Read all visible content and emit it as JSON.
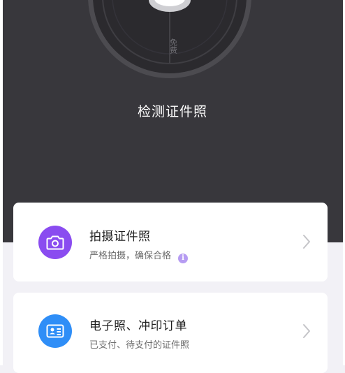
{
  "hero": {
    "title": "检测证件照",
    "dial_label": "免费"
  },
  "cards": [
    {
      "title": "拍摄证件照",
      "subtitle": "严格拍摄，确保合格",
      "icon": "camera-icon",
      "info_icon": "info-icon",
      "info_glyph": "i",
      "icon_color": "#8a4cf0"
    },
    {
      "title": "电子照、冲印订单",
      "subtitle": "已支付、待支付的证件照",
      "icon": "id-card-icon",
      "icon_color": "#2f8ef7"
    }
  ],
  "colors": {
    "hero_background": "#38373c",
    "page_background": "#f2f1f6",
    "card_background": "#ffffff"
  }
}
